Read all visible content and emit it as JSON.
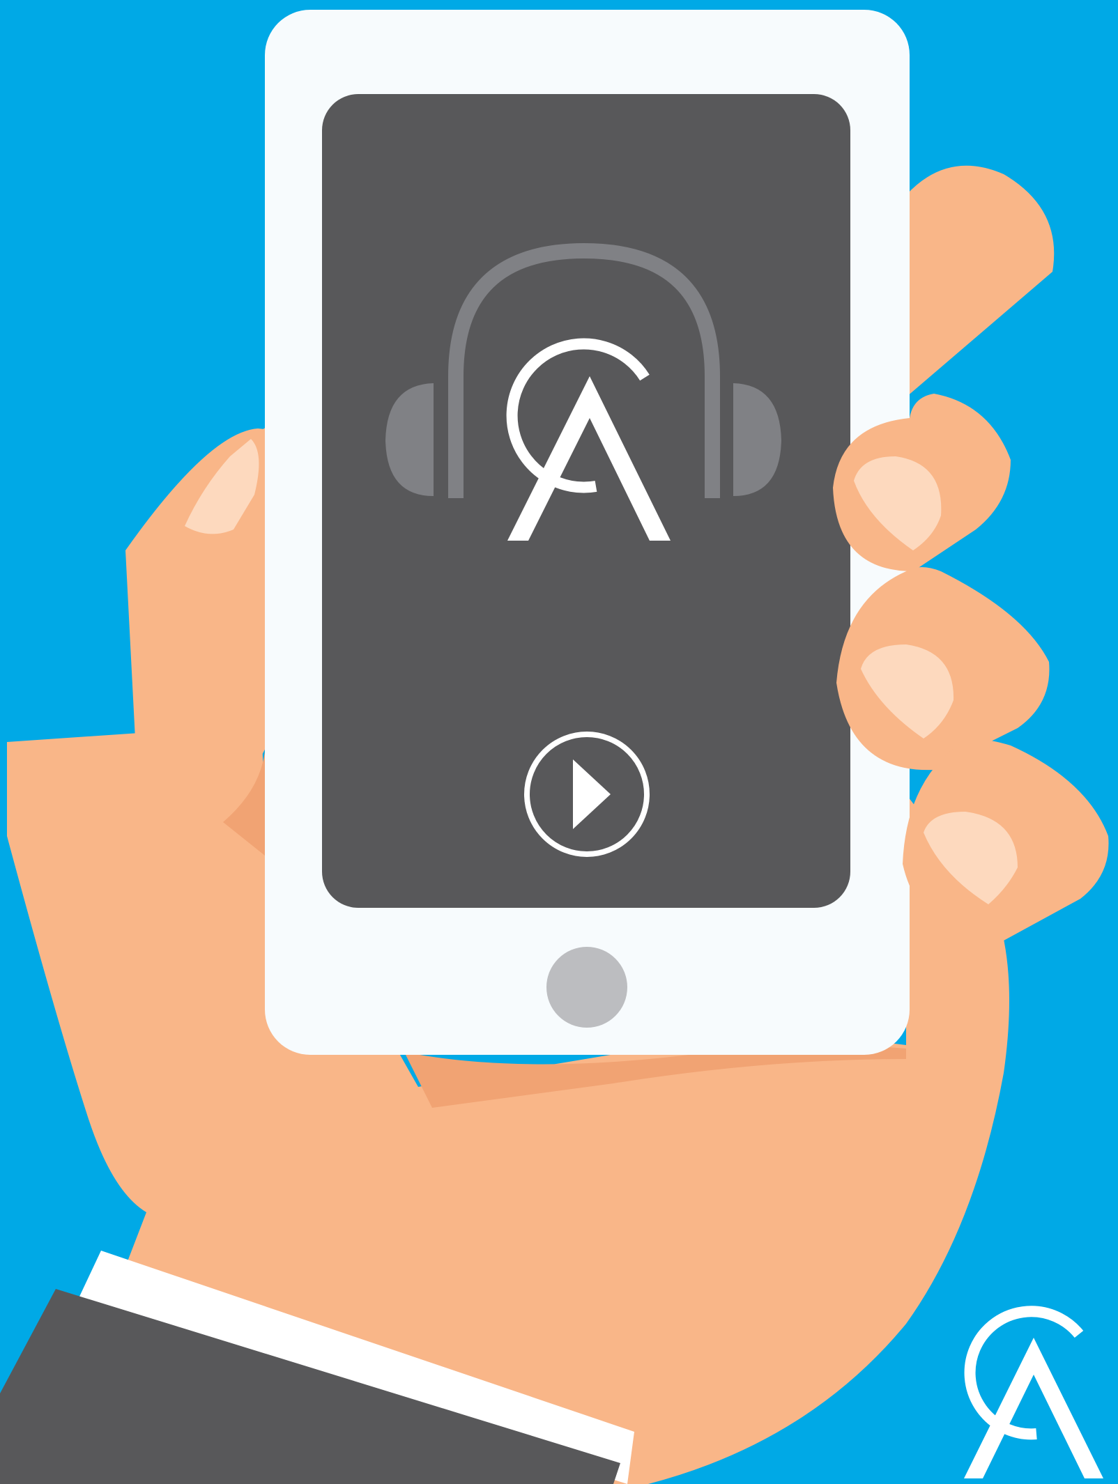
{
  "meta": {
    "logo_text": "CA"
  },
  "colors": {
    "background": "#00A9E6",
    "phone_body": "#F7FBFD",
    "screen": "#58585A",
    "headphones": "#808185",
    "skin": "#F9B688",
    "skin_shadow": "#F1A373",
    "nails": "#FDD9BE",
    "home_button": "#BCBDC0",
    "cuff": "#FFFFFF",
    "sleeve": "#58585A",
    "logo": "#FFFFFF"
  },
  "icons": {
    "headphones": "headphones-icon",
    "play": "play-icon",
    "home": "home-button",
    "logo": "ca-logo"
  },
  "player": {
    "state": "paused"
  }
}
